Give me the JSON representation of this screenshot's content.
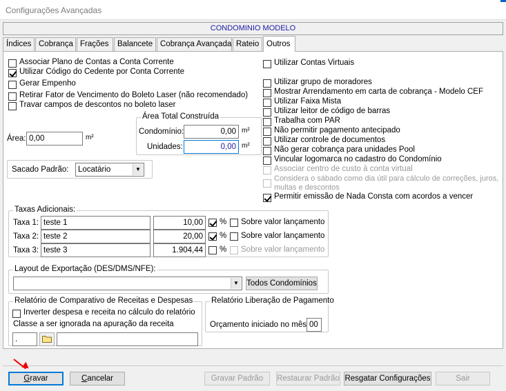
{
  "window": {
    "title": "Configurações Avançadas"
  },
  "header": {
    "condominio": "CONDOMINIO MODELO"
  },
  "tabs": [
    {
      "label": "Índices"
    },
    {
      "label": "Cobrança"
    },
    {
      "label": "Frações"
    },
    {
      "label": "Balancete"
    },
    {
      "label": "Cobrança Avançada"
    },
    {
      "label": "Rateio"
    },
    {
      "label": "Outros",
      "active": true
    }
  ],
  "left_checks": [
    {
      "label": "Associar Plano de Contas a Conta Corrente",
      "checked": false
    },
    {
      "label": "Utilizar Código do Cedente por Conta Corrente",
      "checked": true
    },
    {
      "label": "Gerar Empenho",
      "checked": false
    },
    {
      "label": "Retirar Fator de Vencimento do Boleto Laser (não recomendado)",
      "checked": false
    },
    {
      "label": "Travar campos de descontos no boleto laser",
      "checked": false
    }
  ],
  "area": {
    "label": "Área:",
    "value": "0,00",
    "unit": "m²"
  },
  "area_total": {
    "title": "Área Total Construída",
    "condominio_label": "Condomínio:",
    "condominio_value": "0,00",
    "condominio_unit": "m²",
    "unidades_label": "Unidades:",
    "unidades_value": "0,00",
    "unidades_unit": "m²"
  },
  "sacado": {
    "label": "Sacado Padrão:",
    "value": "Locatário"
  },
  "right_checks": [
    {
      "label": "Utilizar Contas Virtuais",
      "checked": false,
      "disabled": false
    },
    {
      "label": "Utilizar grupo de moradores",
      "checked": false,
      "disabled": false
    },
    {
      "label": "Mostrar Arrendamento em carta de cobrança - Modelo CEF",
      "checked": false,
      "disabled": false
    },
    {
      "label": "Utilizar Faixa Mista",
      "checked": false,
      "disabled": false
    },
    {
      "label": "Utilizar leitor de código de barras",
      "checked": false,
      "disabled": false
    },
    {
      "label": "Trabalha com PAR",
      "checked": false,
      "disabled": false
    },
    {
      "label": "Não permitir pagamento antecipado",
      "checked": false,
      "disabled": false
    },
    {
      "label": "Utilizar controle de documentos",
      "checked": false,
      "disabled": false
    },
    {
      "label": "Não gerar cobrança para unidades Pool",
      "checked": false,
      "disabled": false
    },
    {
      "label": "Vincular logomarca no cadastro do Condomínio",
      "checked": false,
      "disabled": false
    },
    {
      "label": "Associar centro de custo à conta virtual",
      "checked": false,
      "disabled": true
    },
    {
      "label": "Considera o sábado como dia útil para cálculo de correções, juros, multas e descontos",
      "line1": "Considera o sábado como dia útil para cálculo de correções, juros,",
      "line2": "multas e descontos",
      "checked": false,
      "disabled": true
    },
    {
      "label": "Permitir emissão de Nada Consta com acordos a vencer",
      "checked": true,
      "disabled": false
    }
  ],
  "taxas": {
    "title": "Taxas Adicionais:",
    "rows": [
      {
        "label": "Taxa 1:",
        "name": "teste 1",
        "value": "10,00",
        "percent_checked": true,
        "percent_label": "%",
        "sobre_label": "Sobre valor lançamento",
        "sobre_checked": false,
        "sobre_disabled": false
      },
      {
        "label": "Taxa 2:",
        "name": "teste 2",
        "value": "20,00",
        "percent_checked": true,
        "percent_label": "%",
        "sobre_label": "Sobre valor lançamento",
        "sobre_checked": false,
        "sobre_disabled": false
      },
      {
        "label": "Taxa 3:",
        "name": "teste 3",
        "value": "1.904,44",
        "percent_checked": false,
        "percent_label": "%",
        "sobre_label": "Sobre valor lançamento",
        "sobre_checked": false,
        "sobre_disabled": true
      }
    ]
  },
  "layout_export": {
    "title": "Layout de Exportação (DES/DMS/NFE):",
    "value": "",
    "button": "Todos Condomínios"
  },
  "relatorio_comp": {
    "title": "Relatório de Comparativo de Receitas e Despesas",
    "check_label": "Inverter despesa e receita no cálculo do relatório",
    "class_label": "Classe a ser ignorada na apuração da receita",
    "class_code": ".",
    "class_desc": ""
  },
  "relatorio_lib": {
    "title": "Relatório Liberação de Pagamento",
    "label": "Orçamento iniciado no mês:",
    "value": "00"
  },
  "buttons": {
    "gravar_rest": "ravar",
    "gravar_u": "G",
    "cancelar_rest": "ancelar",
    "cancelar_u": "C",
    "gravar_padrao": "Gravar Padrão",
    "restaurar_padrao": "Restaurar Padrão",
    "resgatar": "Resgatar Configurações",
    "sair": "Sair"
  },
  "colors": {
    "header_text": "#1a1aa6",
    "focus_border": "#0078d7",
    "annotation_arrow": "#e00000"
  }
}
